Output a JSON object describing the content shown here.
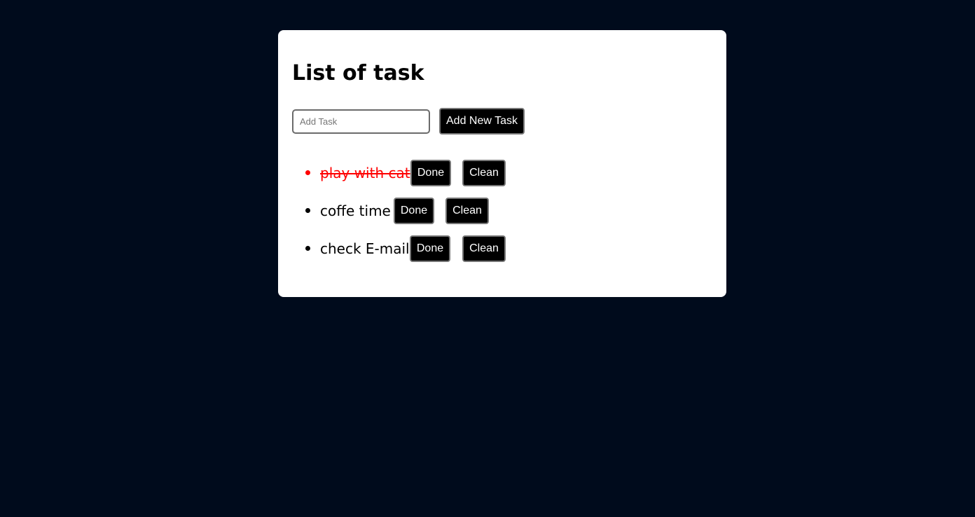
{
  "header": {
    "title": "List of task"
  },
  "add_task": {
    "placeholder": "Add Task",
    "value": "",
    "button_label": "Add New Task"
  },
  "tasks": [
    {
      "label": "play with cat",
      "done": true,
      "done_label": "Done",
      "clean_label": "Clean"
    },
    {
      "label": "coffe time",
      "done": false,
      "done_label": "Done",
      "clean_label": "Clean"
    },
    {
      "label": "check E-mail",
      "done": false,
      "done_label": "Done",
      "clean_label": "Clean"
    }
  ],
  "colors": {
    "background": "#000b1c",
    "card": "#ffffff",
    "done_text": "#ff0000",
    "button_bg": "#000000"
  }
}
